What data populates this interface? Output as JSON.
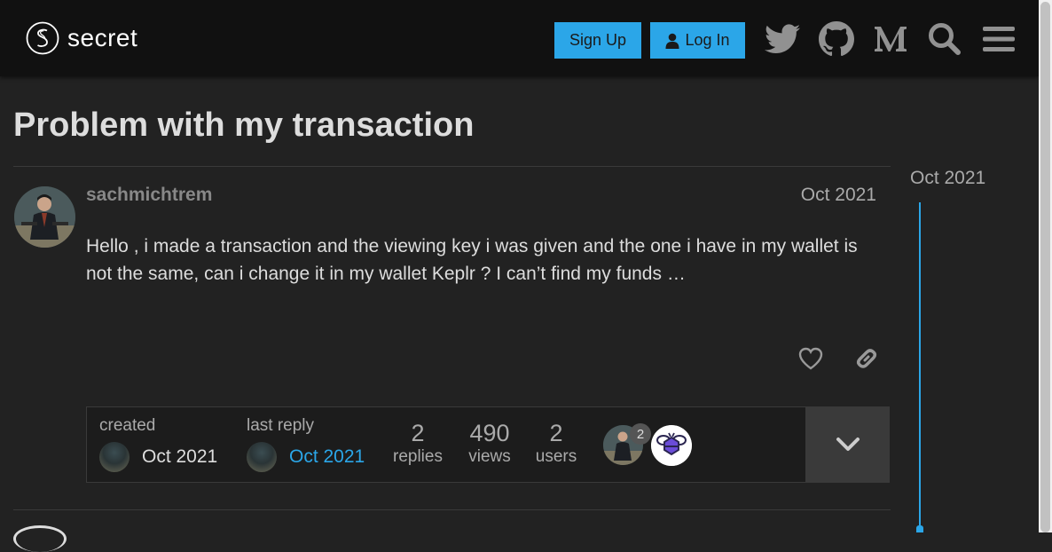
{
  "header": {
    "logo_text": "secret",
    "signup_label": "Sign Up",
    "login_label": "Log In",
    "icons": [
      "twitter-icon",
      "github-icon",
      "medium-icon",
      "search-icon",
      "menu-icon"
    ]
  },
  "topic": {
    "title": "Problem with my transaction"
  },
  "post": {
    "username": "sachmichtrem",
    "date": "Oct 2021",
    "body": "Hello , i made a transaction and the viewing key i was given and the one i have in my wallet is not the same, can i change it in my wallet Keplr ? I can’t find my funds …"
  },
  "topic_map": {
    "created_label": "created",
    "created_date": "Oct 2021",
    "last_reply_label": "last reply",
    "last_reply_date": "Oct 2021",
    "replies_count": "2",
    "replies_label": "replies",
    "views_count": "490",
    "views_label": "views",
    "users_count": "2",
    "users_label": "users",
    "participant_badge": "2"
  },
  "timeline": {
    "date": "Oct 2021"
  },
  "colors": {
    "accent": "#2ba6e8",
    "background": "#222222",
    "header": "#111111"
  }
}
